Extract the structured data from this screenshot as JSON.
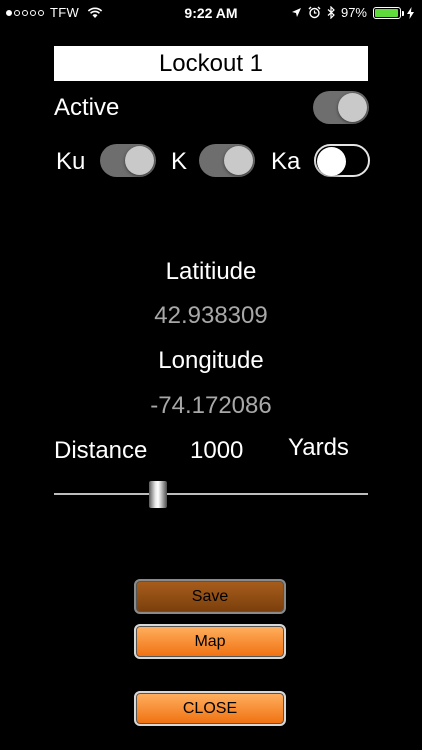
{
  "status_bar": {
    "signal_dots_filled": 1,
    "signal_dots_total": 5,
    "carrier": "TFW",
    "time": "9:22 AM",
    "battery_percent": "97%",
    "battery_level": 0.97,
    "icons": [
      "location-arrow-icon",
      "alarm-icon",
      "bluetooth-icon",
      "charging-bolt-icon"
    ]
  },
  "title": "Lockout 1",
  "active": {
    "label": "Active",
    "on": true
  },
  "bands": [
    {
      "label": "Ku",
      "on": true
    },
    {
      "label": "K",
      "on": true
    },
    {
      "label": "Ka",
      "on": false
    }
  ],
  "latitude": {
    "label": "Latitiude",
    "value": "42.938309"
  },
  "longitude": {
    "label": "Longitude",
    "value": "-74.172086"
  },
  "distance": {
    "label": "Distance",
    "value": "1000",
    "unit": "Yards",
    "slider_fraction": 0.32
  },
  "buttons": {
    "save": "Save",
    "map": "Map",
    "close": "CLOSE"
  },
  "colors": {
    "button_orange": "#f28a2e",
    "save_brown": "#8f4c14",
    "battery_green": "#5fdc3c"
  }
}
